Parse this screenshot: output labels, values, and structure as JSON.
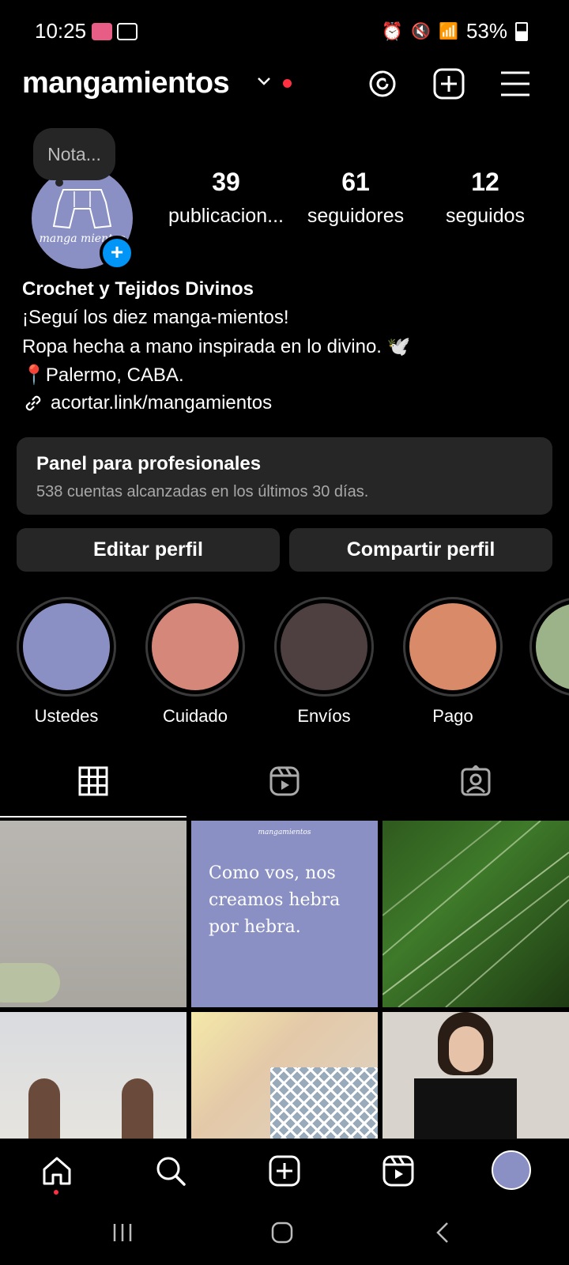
{
  "status_bar": {
    "time": "10:25",
    "battery": "53%"
  },
  "header": {
    "username": "mangamientos"
  },
  "profile": {
    "note_placeholder": "Nota...",
    "avatar_text": "manga mientos",
    "stats": [
      {
        "value": "39",
        "label": "publicacion..."
      },
      {
        "value": "61",
        "label": "seguidores"
      },
      {
        "value": "12",
        "label": "seguidos"
      }
    ],
    "bio": {
      "name": "Crochet y Tejidos Divinos",
      "line1": "¡Seguí los diez manga-mientos!",
      "line2": "Ropa hecha a mano inspirada en lo divino. 🕊️",
      "line3": "📍Palermo, CABA.",
      "link": "acortar.link/mangamientos"
    }
  },
  "pro_panel": {
    "title": "Panel para profesionales",
    "subtitle": "538 cuentas alcanzadas en los últimos 30 días."
  },
  "buttons": {
    "edit": "Editar perfil",
    "share": "Compartir perfil"
  },
  "highlights": [
    {
      "label": "Ustedes",
      "color": "#8a90c4"
    },
    {
      "label": "Cuidado",
      "color": "#d5877a"
    },
    {
      "label": "Envíos",
      "color": "#4e4040"
    },
    {
      "label": "Pago",
      "color": "#d98a68"
    },
    {
      "label": "",
      "color": "#9cb38a"
    }
  ],
  "grid": {
    "post2_brand": "mangamientos",
    "post2_text": "Como vos, nos creamos hebra por hebra."
  },
  "colors": {
    "accent_blue": "#0095f6",
    "notification_red": "#ff3040",
    "panel_bg": "#262626"
  },
  "icons": [
    "threads-icon",
    "new-post-icon",
    "menu-icon",
    "grid-icon",
    "reels-icon",
    "tagged-icon",
    "home-icon",
    "search-icon",
    "create-icon",
    "reels-nav-icon"
  ]
}
